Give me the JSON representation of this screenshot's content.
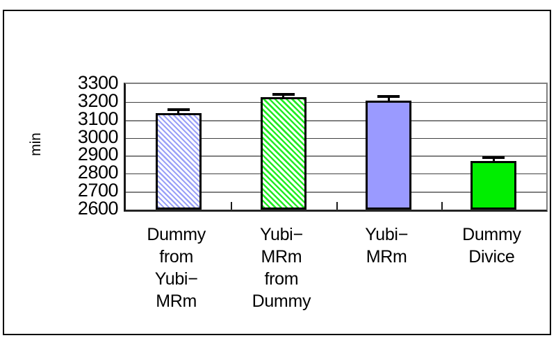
{
  "chart_data": {
    "type": "bar",
    "title": "",
    "xlabel": "",
    "ylabel": "min",
    "ylim": [
      2600,
      3300
    ],
    "ytick_step": 100,
    "ytick_labels": [
      "3300",
      "3200",
      "3100",
      "3000",
      "2900",
      "2800",
      "2700",
      "2600"
    ],
    "grid": true,
    "legend": "none",
    "categories": [
      "Dummy\nfrom\nYubi−\nMRm",
      "Yubi−\nMRm\nfrom\nDummy",
      "Yubi−\nMRm",
      "Dummy\nDivice"
    ],
    "values": [
      3137,
      3228,
      3208,
      2872
    ],
    "errors": [
      28,
      22,
      30,
      24
    ],
    "bar_styles": [
      "hatched-blue",
      "hatched-green",
      "solid-blue",
      "solid-green"
    ],
    "colors": {
      "bar1": "#9aa0f7",
      "bar2": "#22ee22",
      "bar3": "#9a9aff",
      "bar4": "#00ee00",
      "bar_outline": "#000000",
      "gridline": "#404040",
      "axis": "#1a1a1a",
      "background": "#ffffff"
    }
  },
  "axis": {
    "y_title": "min",
    "y_ticks": [
      {
        "label": "3300",
        "value": 3300
      },
      {
        "label": "3200",
        "value": 3200
      },
      {
        "label": "3100",
        "value": 3100
      },
      {
        "label": "3000",
        "value": 3000
      },
      {
        "label": "2900",
        "value": 2900
      },
      {
        "label": "2800",
        "value": 2800
      },
      {
        "label": "2700",
        "value": 2700
      },
      {
        "label": "2600",
        "value": 2600
      }
    ]
  },
  "categories": [
    {
      "lines": [
        "Dummy",
        "from",
        "Yubi−",
        "MRm"
      ]
    },
    {
      "lines": [
        "Yubi−",
        "MRm",
        "from",
        "Dummy"
      ]
    },
    {
      "lines": [
        "Yubi−",
        "MRm"
      ]
    },
    {
      "lines": [
        "Dummy",
        "Divice"
      ]
    }
  ]
}
